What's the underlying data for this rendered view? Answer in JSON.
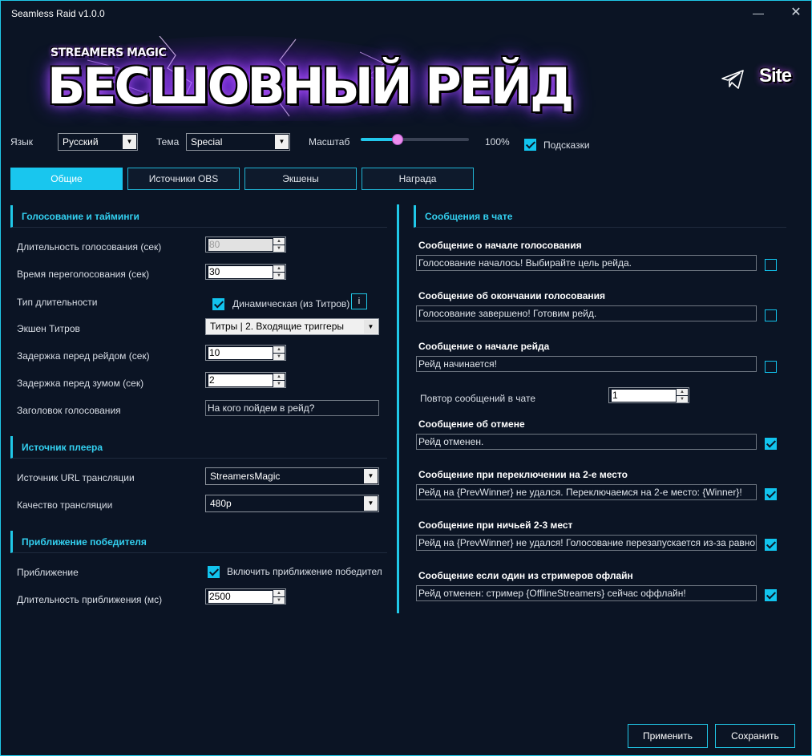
{
  "window": {
    "title": "Seamless Raid v1.0.0",
    "minimize": "—",
    "close": "✕"
  },
  "banner": {
    "subtitle": "STREAMERS MAGIC",
    "title": "БЕСШОВНЫЙ РЕЙД",
    "site": "Site",
    "telegram_icon": "telegram-icon"
  },
  "topbar": {
    "language_label": "Язык",
    "language_value": "Русский",
    "theme_label": "Тема",
    "theme_value": "Special",
    "scale_label": "Масштаб",
    "scale_value": "100%",
    "scale_fraction": 0.34,
    "hints_label": "Подсказки",
    "hints_checked": true
  },
  "tabs": [
    {
      "label": "Общие",
      "active": true
    },
    {
      "label": "Источники OBS",
      "active": false
    },
    {
      "label": "Экшены",
      "active": false
    },
    {
      "label": "Награда",
      "active": false
    }
  ],
  "voting": {
    "header": "Голосование и тайминги",
    "duration_label": "Длительность голосования (сек)",
    "duration_value": "80",
    "revote_label": "Время переголосования (сек)",
    "revote_value": "30",
    "duration_type_label": "Тип длительности",
    "duration_type_check": "Динамическая (из Титров)",
    "info": "i",
    "titles_action_label": "Экшен Титров",
    "titles_action_value": "Титры | 2. Входящие триггеры",
    "raid_delay_label": "Задержка перед рейдом (сек)",
    "raid_delay_value": "10",
    "zoom_delay_label": "Задержка перед зумом (сек)",
    "zoom_delay_value": "2",
    "vote_title_label": "Заголовок голосования",
    "vote_title_value": "На кого пойдем в рейд?"
  },
  "player": {
    "header": "Источник плеера",
    "url_source_label": "Источник URL трансляции",
    "url_source_value": "StreamersMagic",
    "quality_label": "Качество трансляции",
    "quality_value": "480p"
  },
  "zoom": {
    "header": "Приближение победителя",
    "zoom_label": "Приближение",
    "zoom_check": "Включить приближение победител",
    "zoom_duration_label": "Длительность приближения (мс)",
    "zoom_duration_value": "2500"
  },
  "chat": {
    "header": "Сообщения в чате",
    "repeat_label": "Повтор сообщений в чате",
    "repeat_value": "1",
    "messages": [
      {
        "title": "Сообщение о начале голосования",
        "text": "Голосование началось! Выбирайте цель рейда.",
        "checked": false
      },
      {
        "title": "Сообщение об окончании голосования",
        "text": "Голосование завершено! Готовим рейд.",
        "checked": false
      },
      {
        "title": "Сообщение о начале рейда",
        "text": "Рейд начинается!",
        "checked": false
      },
      {
        "title": "Сообщение об отмене",
        "text": "Рейд отменен.",
        "checked": true
      },
      {
        "title": "Сообщение при переключении на 2-е место",
        "text": "Рейд на {PrevWinner} не удался. Переключаемся на 2-е место: {Winner}!",
        "checked": true
      },
      {
        "title": "Сообщение при ничьей 2-3 мест",
        "text": "Рейд на {PrevWinner} не удался! Голосование перезапускается из-за равного кол",
        "checked": true
      },
      {
        "title": "Сообщение если один из стримеров офлайн",
        "text": "Рейд отменен: стример {OfflineStreamers} сейчас оффлайн!",
        "checked": true
      }
    ]
  },
  "footer": {
    "apply": "Применить",
    "save": "Сохранить"
  },
  "colors": {
    "accent": "#20c8e8",
    "background": "#0b1424",
    "slider_thumb": "#ee8df0"
  }
}
